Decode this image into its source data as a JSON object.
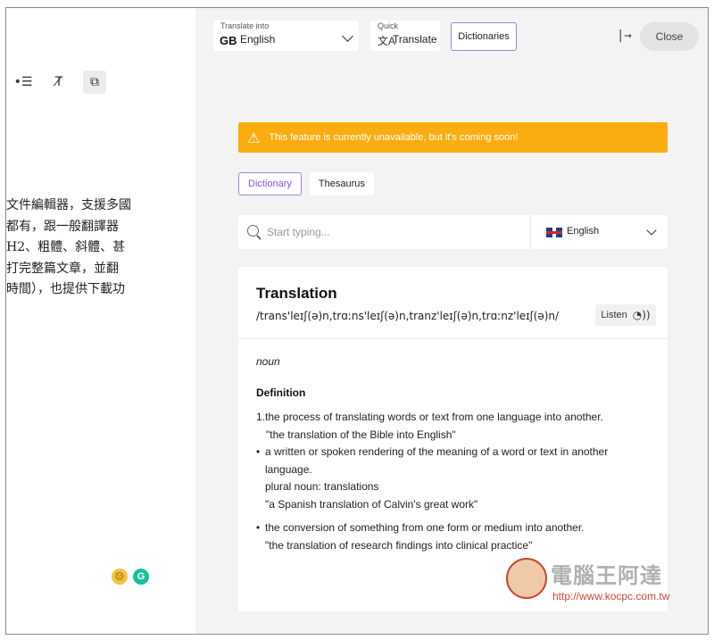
{
  "editor": {
    "toolbar": [
      {
        "icon": "bullet-list-icon",
        "glyph": "•☰"
      },
      {
        "icon": "clear-format-icon",
        "glyph": "T̸"
      },
      {
        "icon": "copy-icon",
        "glyph": "⧉"
      }
    ],
    "text_lines": [
      "文件編輯器，支援多國",
      "都有，跟一般翻譯器",
      "H2、粗體、斜體、甚",
      "打完整篇文章，並翻",
      "時間），也提供下載功"
    ],
    "emoji": "😐",
    "grammarly": "G"
  },
  "panel": {
    "translate_into_label": "Translate into",
    "lang_code": "GB",
    "lang_name": "English",
    "quick_label": "Quick",
    "quick_icon": "文A",
    "quick_text": "Translate",
    "dictionaries_label": "Dictionaries",
    "close_arrow": "|→",
    "close_label": "Close"
  },
  "banner": {
    "icon": "warning-icon",
    "text": "This feature is currently unavailable, but it's coming soon!",
    "color": "#fbac0f"
  },
  "tabs": [
    {
      "label": "Dictionary",
      "active": true
    },
    {
      "label": "Thesaurus",
      "active": false
    }
  ],
  "search": {
    "placeholder": "Start typing...",
    "language": "English"
  },
  "entry": {
    "word": "Translation",
    "phonetic": "/trans'leɪʃ(ə)n,trɑːns'leɪʃ(ə)n,tranz'leɪʃ(ə)n,trɑːnz'leɪʃ(ə)n/",
    "listen_label": "Listen",
    "part_of_speech": "noun",
    "definition_heading": "Definition",
    "definitions": [
      {
        "marker": "1.",
        "lines": [
          "the process of translating words or text from one language into another.",
          "\"the translation of the Bible into English\""
        ]
      },
      {
        "marker": "•",
        "lines": [
          "a written or spoken rendering of the meaning of a word or text in another language.",
          "plural noun: translations",
          "\"a Spanish translation of Calvin's great work\""
        ]
      },
      {
        "marker": "•",
        "lines": [
          "the conversion of something from one form or medium into another.",
          "\"the translation of research findings into clinical practice\""
        ]
      }
    ]
  },
  "watermark": {
    "title": "電腦王阿達",
    "url": "http://www.kocpc.com.tw"
  },
  "colors": {
    "accent_purple": "#a57fe0",
    "panel_bg": "#f3f3f4",
    "banner": "#fbac0f"
  }
}
